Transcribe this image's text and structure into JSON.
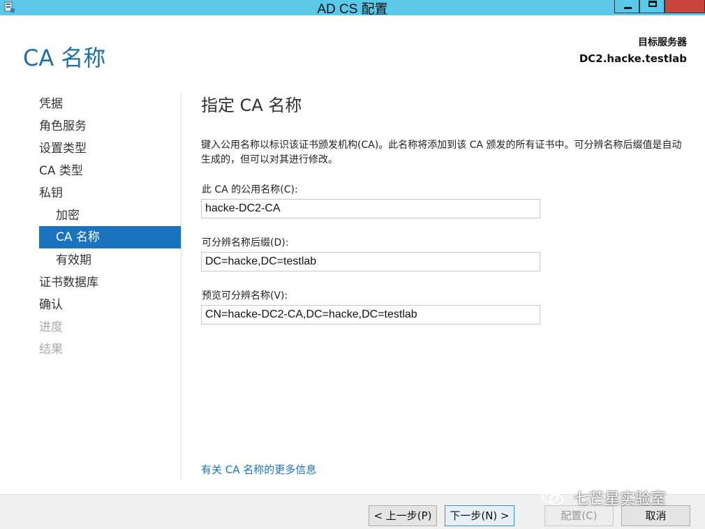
{
  "window": {
    "title": "AD CS 配置"
  },
  "header": {
    "page_title": "CA 名称",
    "target_label": "目标服务器",
    "target_server": "DC2.hacke.testlab"
  },
  "nav": {
    "items": [
      {
        "label": "凭据",
        "state": "normal",
        "indent": 0
      },
      {
        "label": "角色服务",
        "state": "normal",
        "indent": 0
      },
      {
        "label": "设置类型",
        "state": "normal",
        "indent": 0
      },
      {
        "label": "CA 类型",
        "state": "normal",
        "indent": 0
      },
      {
        "label": "私钥",
        "state": "normal",
        "indent": 0
      },
      {
        "label": "加密",
        "state": "normal",
        "indent": 1
      },
      {
        "label": "CA 名称",
        "state": "active",
        "indent": 1
      },
      {
        "label": "有效期",
        "state": "normal",
        "indent": 1
      },
      {
        "label": "证书数据库",
        "state": "normal",
        "indent": 0
      },
      {
        "label": "确认",
        "state": "normal",
        "indent": 0
      },
      {
        "label": "进度",
        "state": "disabled",
        "indent": 0
      },
      {
        "label": "结果",
        "state": "disabled",
        "indent": 0
      }
    ]
  },
  "main": {
    "section_title": "指定 CA 名称",
    "description": "键入公用名称以标识该证书颁发机构(CA)。此名称将添加到该 CA 颁发的所有证书中。可分辨名称后缀值是自动生成的，但可以对其进行修改。",
    "common_name_label": "此 CA 的公用名称(C):",
    "common_name_value": "hacke-DC2-CA",
    "dn_suffix_label": "可分辨名称后缀(D):",
    "dn_suffix_value": "DC=hacke,DC=testlab",
    "preview_label": "预览可分辨名称(V):",
    "preview_value": "CN=hacke-DC2-CA,DC=hacke,DC=testlab",
    "more_info_link": "有关 CA 名称的更多信息"
  },
  "footer": {
    "prev": "< 上一步(P)",
    "next": "下一步(N) >",
    "configure": "配置(C)",
    "cancel": "取消"
  },
  "watermark": {
    "text": "七芒星实验室"
  },
  "colors": {
    "titlebar": "#5bc8e8",
    "accent": "#1b73c0",
    "close": "#c7463b",
    "link": "#1a73c2"
  }
}
